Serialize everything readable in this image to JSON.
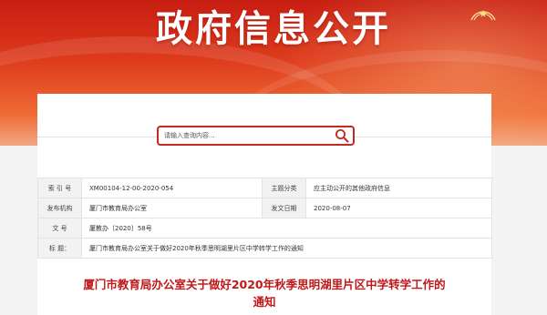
{
  "banner": {
    "title": "政府信息公开"
  },
  "search": {
    "placeholder": "请输入查询内容..."
  },
  "info": {
    "labels": {
      "index_no": "索  引  号",
      "topic": "主题分类",
      "publisher": "发布机构",
      "date": "发文日期",
      "doc_no": "文    号",
      "title": "标    题："
    },
    "values": {
      "index_no": "XM00104-12-00-2020-054",
      "topic": "应主动公开的其他政府信息",
      "publisher": "厦门市教育局办公室",
      "date": "2020-08-07",
      "doc_no": "厦教办〔2020〕58号",
      "title": "厦门市教育局办公室关于做好2020年秋季思明湖里片区中学转学工作的通知"
    }
  },
  "document": {
    "title_line1": "厦门市教育局办公室关于做好2020年秋季思明湖里片区中学转学工作的",
    "title_line2": "通知"
  },
  "colors": {
    "accent": "#c6281d",
    "title_red": "#c01818"
  }
}
